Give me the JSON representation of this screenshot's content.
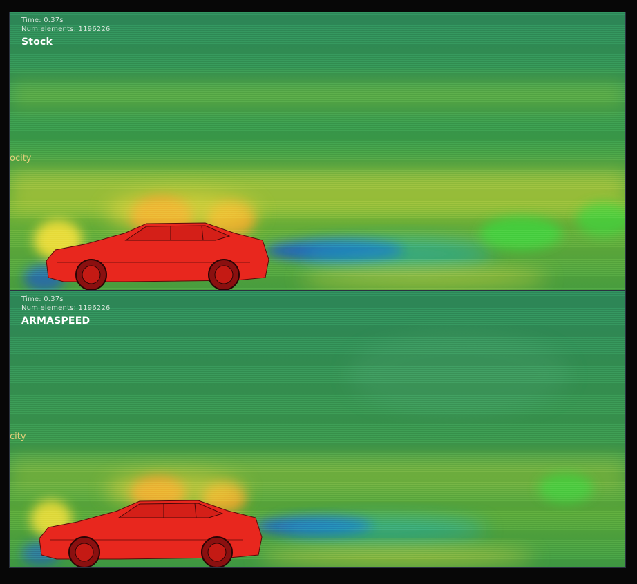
{
  "panels": [
    {
      "time_text": "Time: 0.37s",
      "elements_text": "Num elements: 1196226",
      "label": "Stock",
      "legend_fragment": "ocity"
    },
    {
      "time_text": "Time: 0.37s",
      "elements_text": "Num elements: 1196226",
      "label": "ARMASPEED",
      "legend_fragment": "city"
    }
  ],
  "colors": {
    "background": "#070707",
    "flow_base": "#2f8a58",
    "car_body": "#e8271e",
    "high_velocity": "#f0d23a",
    "low_velocity": "#1b5fd0"
  },
  "icons": [
    "car-model"
  ]
}
